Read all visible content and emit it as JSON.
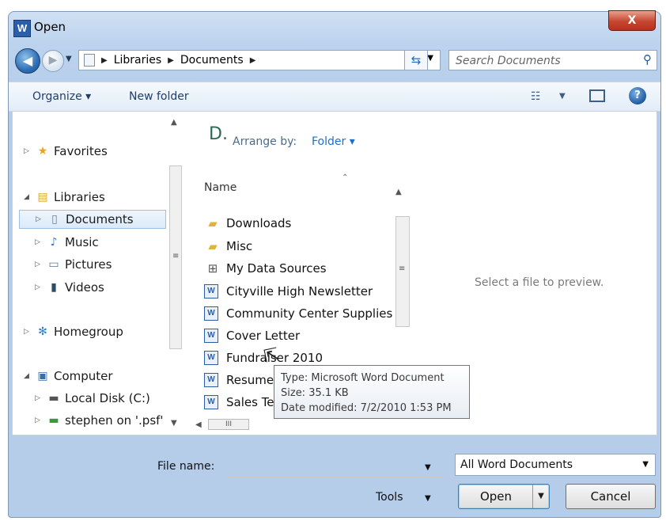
{
  "window": {
    "title": "Open",
    "app_icon": "W",
    "close_label": "X"
  },
  "nav": {
    "back_icon": "back-arrow-icon",
    "forward_icon": "forward-arrow-icon",
    "breadcrumb": [
      "Libraries",
      "Documents"
    ],
    "search_placeholder": "Search Documents"
  },
  "toolbar": {
    "organize": "Organize ▾",
    "new_folder": "New folder"
  },
  "sidebar": {
    "favorites": "Favorites",
    "libraries": "Libraries",
    "documents": "Documents",
    "music": "Music",
    "pictures": "Pictures",
    "videos": "Videos",
    "homegroup": "Homegroup",
    "computer": "Computer",
    "local_disk": "Local Disk (C:)",
    "network_drive": "stephen on '.psf'"
  },
  "library": {
    "title_initial": "D.",
    "arrange_label": "Arrange by:",
    "arrange_value": "Folder ▾",
    "column_name": "Name"
  },
  "files": [
    {
      "name": "Downloads",
      "type": "folder"
    },
    {
      "name": "Misc",
      "type": "folder"
    },
    {
      "name": "My Data Sources",
      "type": "datasource"
    },
    {
      "name": "Cityville High Newsletter",
      "type": "word"
    },
    {
      "name": "Community Center Supplies",
      "type": "word"
    },
    {
      "name": "Cover Letter",
      "type": "word"
    },
    {
      "name": "Fundraiser 2010",
      "type": "word"
    },
    {
      "name": "Resume",
      "type": "word"
    },
    {
      "name": "Sales Te",
      "type": "word"
    }
  ],
  "preview_text": "Select a file to preview.",
  "tooltip": {
    "type": "Type: Microsoft Word Document",
    "size": "Size: 35.1 KB",
    "modified": "Date modified: 7/2/2010 1:53 PM"
  },
  "footer": {
    "file_name_label": "File name:",
    "file_name_value": "",
    "filter": "All Word Documents",
    "tools": "Tools",
    "open": "Open",
    "cancel": "Cancel"
  },
  "scroll_grip": "≡",
  "hscroll_grip": "III"
}
